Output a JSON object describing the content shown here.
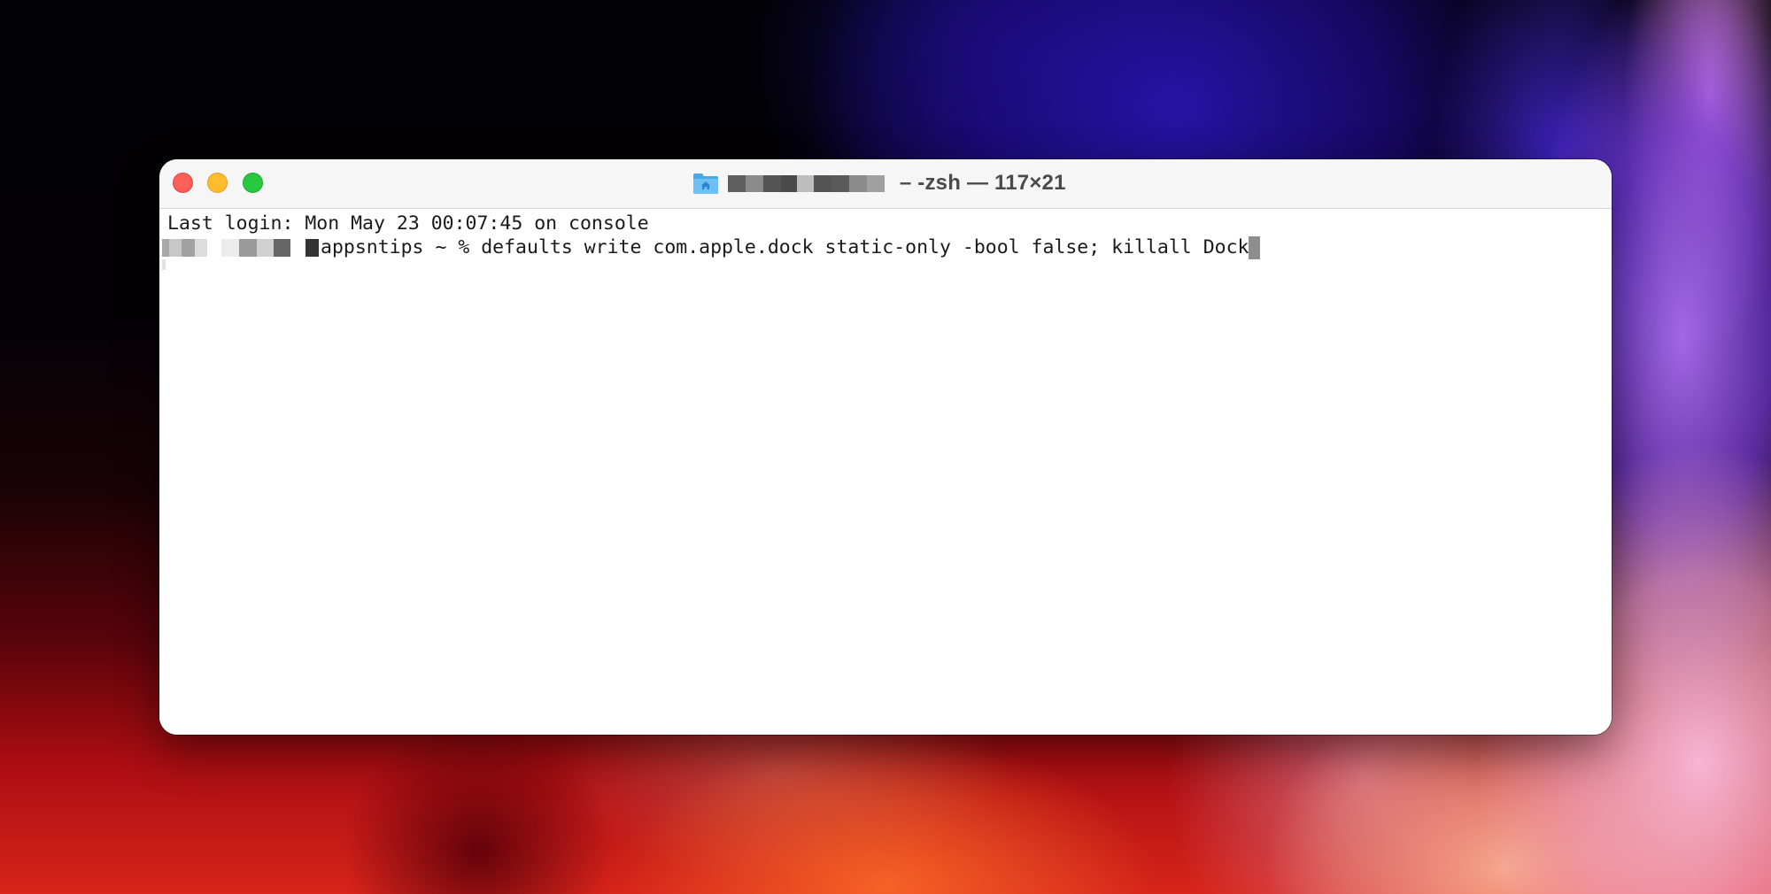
{
  "window": {
    "app": "Terminal",
    "title_suffix": " – -zsh — 117×21",
    "title_redacted": true,
    "traffic_lights": {
      "close": {
        "label": "Close",
        "color": "#fe5f57"
      },
      "minimize": {
        "label": "Minimize",
        "color": "#febc2e"
      },
      "zoom": {
        "label": "Zoom",
        "color": "#28c840"
      }
    },
    "title_icon": "home-folder-icon"
  },
  "terminal": {
    "lines": [
      {
        "text": "Last login: Mon May 23 00:07:45 on console"
      },
      {
        "prompt_redacted": true,
        "prompt_visible": "appsntips ~ % ",
        "command": "defaults write com.apple.dock static-only -bool false; killall Dock"
      }
    ],
    "cursor": "block"
  },
  "colors": {
    "titlebar_bg": "#f6f6f6",
    "terminal_bg": "#ffffff",
    "text": "#1a1a1a",
    "cursor": "#8e8e8e"
  }
}
